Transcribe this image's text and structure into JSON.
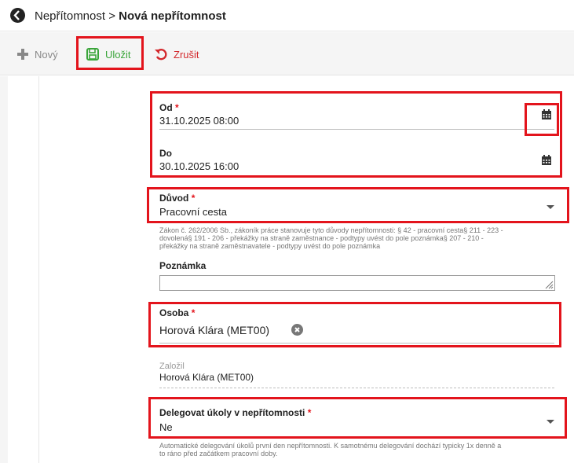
{
  "header": {
    "breadcrumb_parent": "Nepřítomnost",
    "breadcrumb_sep": " > ",
    "breadcrumb_current": "Nová nepřítomnost"
  },
  "toolbar": {
    "new_label": "Nový",
    "save_label": "Uložit",
    "cancel_label": "Zrušit"
  },
  "form": {
    "from": {
      "label": "Od",
      "required_mark": "*",
      "value": "31.10.2025 08:00"
    },
    "to": {
      "label": "Do",
      "value": "30.10.2025 16:00"
    },
    "reason": {
      "label": "Důvod",
      "required_mark": "*",
      "value": "Pracovní cesta",
      "help_line1": "Zákon č. 262/2006 Sb., zákoník práce stanovuje tyto důvody nepřítomnosti: § 42 - pracovní cesta§ 211 - 223 -",
      "help_line2": "dovolená§ 191 - 206 - překážky na straně zaměstnance - podtypy uvést do pole poznámka§ 207 - 210 -",
      "help_line3": "překážky na straně zaměstnavatele - podtypy uvést do pole poznámka"
    },
    "note": {
      "label": "Poznámka",
      "value": ""
    },
    "person": {
      "label": "Osoba",
      "required_mark": "*",
      "value": "Horová Klára (MET00)"
    },
    "created_by": {
      "label": "Založil",
      "value": "Horová Klára (MET00)"
    },
    "delegate": {
      "label": "Delegovat úkoly v nepřítomnosti",
      "required_mark": "*",
      "value": "Ne",
      "help_line1": "Automatické delegování úkolů první den nepřítomnosti. K samotnému delegování dochází typicky 1x denně a",
      "help_line2": "to ráno před začátkem pracovní doby."
    }
  },
  "colors": {
    "accent_save": "#3aa53a",
    "accent_cancel": "#d3292d",
    "highlight": "#e3141c"
  }
}
